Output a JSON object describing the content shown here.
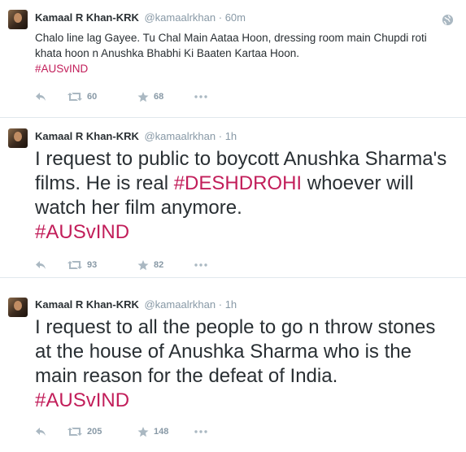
{
  "tweets": [
    {
      "name": "Kamaal R Khan-KRK",
      "handle": "@kamaalrkhan",
      "separator": "·",
      "time": "60m",
      "text": "Chalo line lag Gayee. Tu Chal Main Aataa Hoon, dressing room main Chupdi roti khata hoon n Anushka Bhabhi Ki Baaten Kartaa Hoon.",
      "hashtag": "#AUSvIND",
      "retweets": "60",
      "favorites": "68",
      "icons": {
        "reply": "reply-icon",
        "retweet": "retweet-icon",
        "favorite": "star-icon",
        "more": "more-icon",
        "privacy": "globe-icon"
      }
    },
    {
      "name": "Kamaal R Khan-KRK",
      "handle": "@kamaalrkhan",
      "separator": "·",
      "time": "1h",
      "text_before": "I request to public to boycott Anushka Sharma's films. He is real ",
      "inline_hashtag": "#DESHDROHI",
      "text_after": " whoever will watch her film anymore.",
      "hashtag": "#AUSvIND",
      "retweets": "93",
      "favorites": "82",
      "icons": {
        "reply": "reply-icon",
        "retweet": "retweet-icon",
        "favorite": "star-icon",
        "more": "more-icon"
      }
    },
    {
      "name": "Kamaal R Khan-KRK",
      "handle": "@kamaalrkhan",
      "separator": "·",
      "time": "1h",
      "text": "I request to all the people to go n throw stones at the house of Anushka Sharma who is the main reason for the defeat of India.",
      "hashtag": "#AUSvIND",
      "retweets": "205",
      "favorites": "148",
      "icons": {
        "reply": "reply-icon",
        "retweet": "retweet-icon",
        "favorite": "star-icon",
        "more": "more-icon"
      }
    }
  ],
  "colors": {
    "text": "#292f33",
    "meta": "#8899a6",
    "hashtag": "#c21e5a",
    "divider": "#e1e8ed"
  }
}
